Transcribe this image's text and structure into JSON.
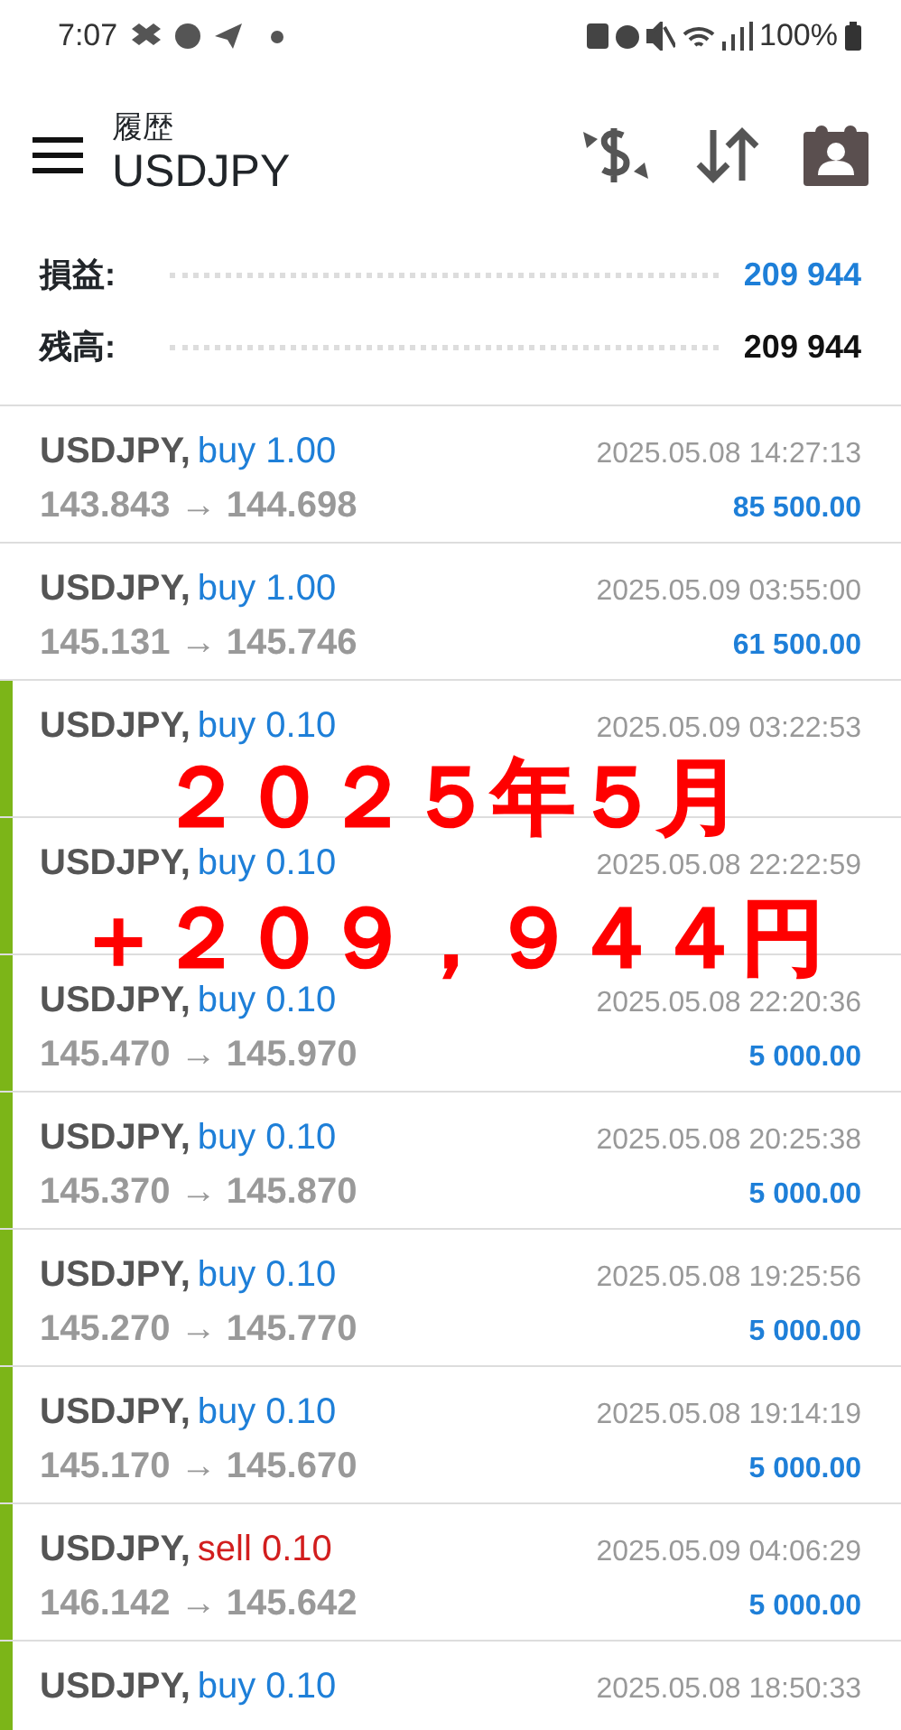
{
  "status_bar": {
    "time": "7:07",
    "battery": "100%"
  },
  "header": {
    "subtitle": "履歴",
    "title": "USDJPY"
  },
  "summary": [
    {
      "label": "損益:",
      "value": "209 944",
      "kind": "profit"
    },
    {
      "label": "残高:",
      "value": "209 944",
      "kind": "balance"
    }
  ],
  "deals": [
    {
      "symbol": "USDJPY,",
      "type": "buy 1.00",
      "sell": false,
      "time": "2025.05.08 14:27:13",
      "prices": "143.843 → 144.698",
      "profit": "85 500.00",
      "marked": false
    },
    {
      "symbol": "USDJPY,",
      "type": "buy 1.00",
      "sell": false,
      "time": "2025.05.09 03:55:00",
      "prices": "145.131 → 145.746",
      "profit": "61 500.00",
      "marked": false
    },
    {
      "symbol": "USDJPY,",
      "type": "buy 0.10",
      "sell": false,
      "time": "2025.05.09 03:22:53",
      "marked": true
    },
    {
      "symbol": "USDJPY,",
      "type": "buy 0.10",
      "sell": false,
      "time": "2025.05.08 22:22:59",
      "marked": true
    },
    {
      "symbol": "USDJPY,",
      "type": "buy 0.10",
      "sell": false,
      "time": "2025.05.08 22:20:36",
      "prices": "145.470 → 145.970",
      "profit": "5 000.00",
      "marked": true
    },
    {
      "symbol": "USDJPY,",
      "type": "buy 0.10",
      "sell": false,
      "time": "2025.05.08 20:25:38",
      "prices": "145.370 → 145.870",
      "profit": "5 000.00",
      "marked": true
    },
    {
      "symbol": "USDJPY,",
      "type": "buy 0.10",
      "sell": false,
      "time": "2025.05.08 19:25:56",
      "prices": "145.270 → 145.770",
      "profit": "5 000.00",
      "marked": true
    },
    {
      "symbol": "USDJPY,",
      "type": "buy 0.10",
      "sell": false,
      "time": "2025.05.08 19:14:19",
      "prices": "145.170 → 145.670",
      "profit": "5 000.00",
      "marked": true
    },
    {
      "symbol": "USDJPY,",
      "type": "sell 0.10",
      "sell": true,
      "time": "2025.05.09 04:06:29",
      "prices": "146.142 → 145.642",
      "profit": "5 000.00",
      "marked": true
    },
    {
      "symbol": "USDJPY,",
      "type": "buy 0.10",
      "sell": false,
      "time": "2025.05.08 18:50:33",
      "marked": true
    }
  ],
  "caption": [
    "２０２５年５月",
    "＋２０９，９４４円"
  ]
}
